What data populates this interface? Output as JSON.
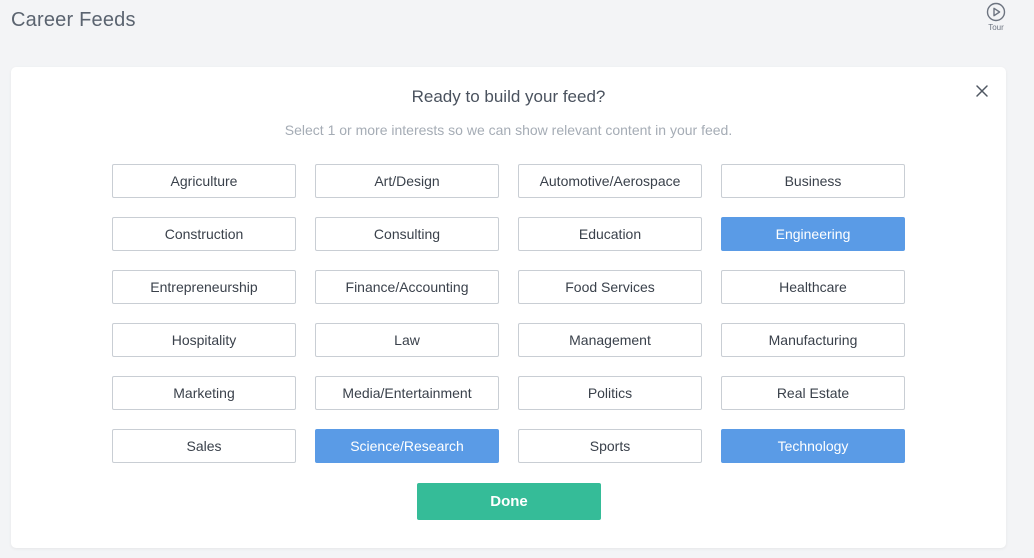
{
  "header": {
    "title": "Career Feeds",
    "tour_label": "Tour",
    "tour_icon": "play-circle-icon"
  },
  "modal": {
    "heading": "Ready to build your feed?",
    "subheading": "Select 1 or more interests so we can show relevant content in your feed.",
    "close_icon": "close-icon",
    "done_label": "Done",
    "colors": {
      "selected": "#5a9be6",
      "done": "#35bc98"
    },
    "interests": [
      {
        "label": "Agriculture",
        "selected": false
      },
      {
        "label": "Art/Design",
        "selected": false
      },
      {
        "label": "Automotive/Aerospace",
        "selected": false
      },
      {
        "label": "Business",
        "selected": false
      },
      {
        "label": "Construction",
        "selected": false
      },
      {
        "label": "Consulting",
        "selected": false
      },
      {
        "label": "Education",
        "selected": false
      },
      {
        "label": "Engineering",
        "selected": true
      },
      {
        "label": "Entrepreneurship",
        "selected": false
      },
      {
        "label": "Finance/Accounting",
        "selected": false
      },
      {
        "label": "Food Services",
        "selected": false
      },
      {
        "label": "Healthcare",
        "selected": false
      },
      {
        "label": "Hospitality",
        "selected": false
      },
      {
        "label": "Law",
        "selected": false
      },
      {
        "label": "Management",
        "selected": false
      },
      {
        "label": "Manufacturing",
        "selected": false
      },
      {
        "label": "Marketing",
        "selected": false
      },
      {
        "label": "Media/Entertainment",
        "selected": false
      },
      {
        "label": "Politics",
        "selected": false
      },
      {
        "label": "Real Estate",
        "selected": false
      },
      {
        "label": "Sales",
        "selected": false
      },
      {
        "label": "Science/Research",
        "selected": true
      },
      {
        "label": "Sports",
        "selected": false
      },
      {
        "label": "Technology",
        "selected": true
      }
    ]
  }
}
